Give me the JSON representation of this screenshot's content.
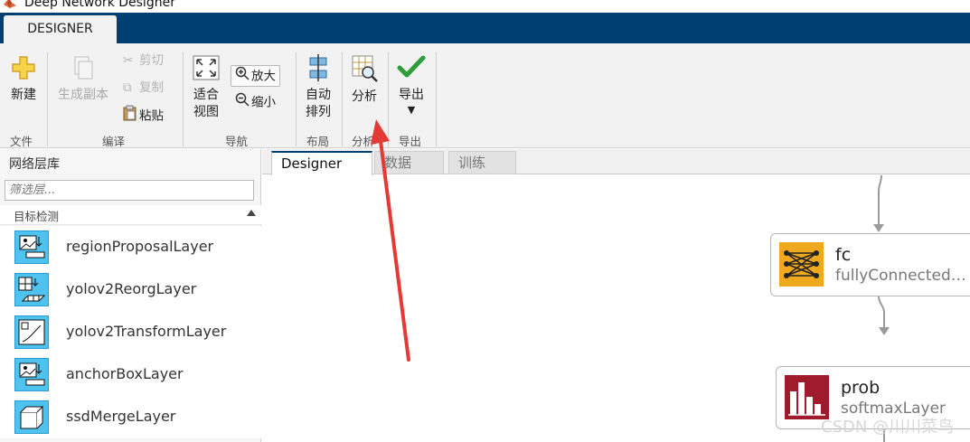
{
  "app": {
    "title": "Deep Network Designer"
  },
  "ribbon": {
    "active_tab": "DESIGNER"
  },
  "toolstrip": {
    "file": {
      "group_label": "文件",
      "new_label": "新建"
    },
    "edit": {
      "group_label": "编译",
      "duplicate_label": "生成副本",
      "cut_label": "剪切",
      "copy_label": "复制",
      "paste_label": "粘贴"
    },
    "navigate": {
      "group_label": "导航",
      "fit_line1": "适合",
      "fit_line2": "视图",
      "zoom_in_label": "放大",
      "zoom_out_label": "缩小"
    },
    "layout": {
      "group_label": "布局",
      "auto_line1": "自动",
      "auto_line2": "排列"
    },
    "analyze": {
      "group_label": "分析",
      "analyze_label": "分析"
    },
    "export": {
      "group_label": "导出",
      "export_label": "导出"
    }
  },
  "library": {
    "header": "网络层库",
    "filter_placeholder": "筛选层...",
    "category": "目标检测",
    "layers": [
      {
        "name": "regionProposalLayer",
        "icon": "region-proposal-icon"
      },
      {
        "name": "yolov2ReorgLayer",
        "icon": "yolov2-reorg-icon"
      },
      {
        "name": "yolov2TransformLayer",
        "icon": "yolov2-transform-icon"
      },
      {
        "name": "anchorBoxLayer",
        "icon": "anchor-box-icon"
      },
      {
        "name": "ssdMergeLayer",
        "icon": "ssd-merge-icon"
      }
    ]
  },
  "doc_tabs": {
    "designer": "Designer",
    "data": "数据",
    "train": "训练"
  },
  "canvas": {
    "nodes": [
      {
        "name": "fc",
        "type": "fullyConnected…",
        "icon": "fully-connected-icon",
        "icon_color": "#f0a81e"
      },
      {
        "name": "prob",
        "type": "softmaxLayer",
        "icon": "softmax-icon",
        "icon_color": "#a01c2c"
      }
    ]
  },
  "annotation": {
    "arrow_color": "#e53935"
  },
  "watermark": "CSDN @川川菜鸟"
}
